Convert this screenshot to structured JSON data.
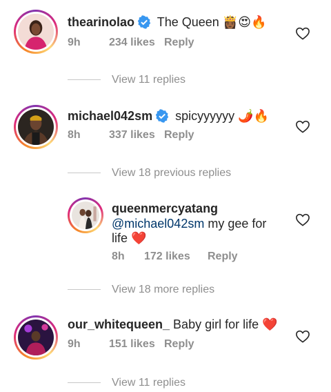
{
  "colors": {
    "username": "#262626",
    "muted": "#8e8e8e",
    "mention": "#00376b",
    "verified": "#3897f0",
    "heart_red": "#ed4956"
  },
  "comments": [
    {
      "username": "thearinolao",
      "verified": true,
      "text": "The Queen",
      "emoji": "👸🏾😍🔥",
      "time": "9h",
      "likes": "234 likes",
      "reply_label": "Reply",
      "view_replies": "View 11 replies",
      "avatar": "woman-pink-dress-avatar"
    },
    {
      "username": "michael042sm",
      "verified": true,
      "text": "spicyyyyyy",
      "emoji": "🌶️🔥",
      "time": "8h",
      "likes": "337 likes",
      "reply_label": "Reply",
      "view_replies": "View 18 previous replies",
      "avatar": "man-avatar"
    },
    {
      "username": "our_whitequeen_",
      "verified": false,
      "text": "Baby girl for life",
      "emoji": "❤️",
      "time": "9h",
      "likes": "151 likes",
      "reply_label": "Reply",
      "view_replies": "View 11 replies",
      "avatar": "purple-stage-avatar"
    }
  ],
  "reply": {
    "username": "queenmercyatang",
    "mention": "@michael042sm",
    "text_line1": "my gee for",
    "text_line2": "life",
    "emoji": "❤️",
    "time": "8h",
    "likes": "172 likes",
    "reply_label": "Reply",
    "view_more": "View 18 more replies",
    "avatar": "couple-avatar"
  }
}
